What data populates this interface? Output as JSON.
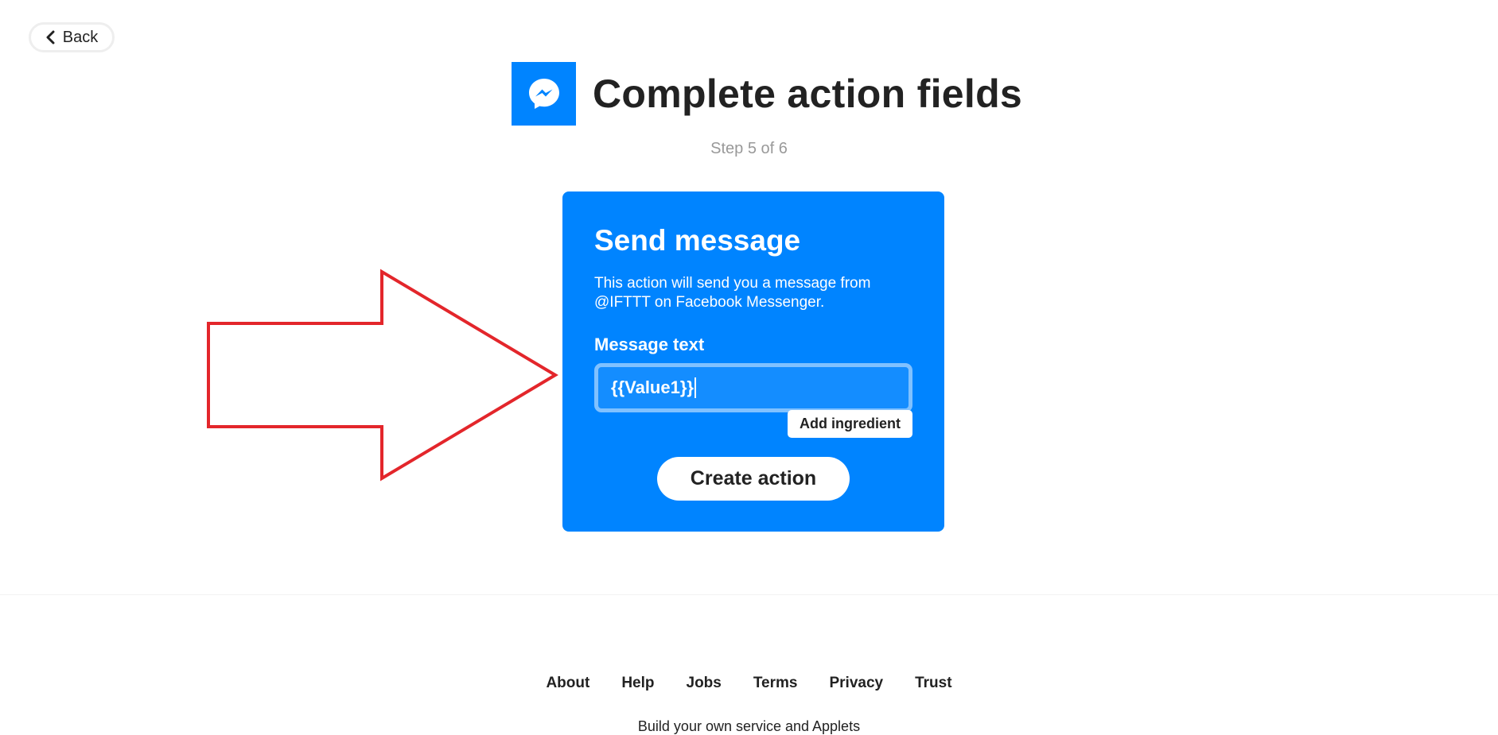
{
  "back": {
    "label": "Back"
  },
  "header": {
    "service_icon": "messenger-icon",
    "title": "Complete action fields",
    "step": "Step 5 of 6"
  },
  "action_card": {
    "title": "Send message",
    "description": "This action will send you a message from @IFTTT on Facebook Messenger.",
    "field_label": "Message text",
    "field_value": "{{Value1}}",
    "add_ingredient_label": "Add ingredient",
    "create_label": "Create action"
  },
  "annotation": {
    "arrow_color": "#e3262b",
    "shape": "right-arrow-outline"
  },
  "footer": {
    "links": [
      "About",
      "Help",
      "Jobs",
      "Terms",
      "Privacy",
      "Trust"
    ],
    "tagline": "Build your own service and Applets"
  },
  "colors": {
    "brand_blue": "#0084ff",
    "input_border": "#80c1ff",
    "text_dark": "#222222",
    "step_gray": "#999999"
  }
}
